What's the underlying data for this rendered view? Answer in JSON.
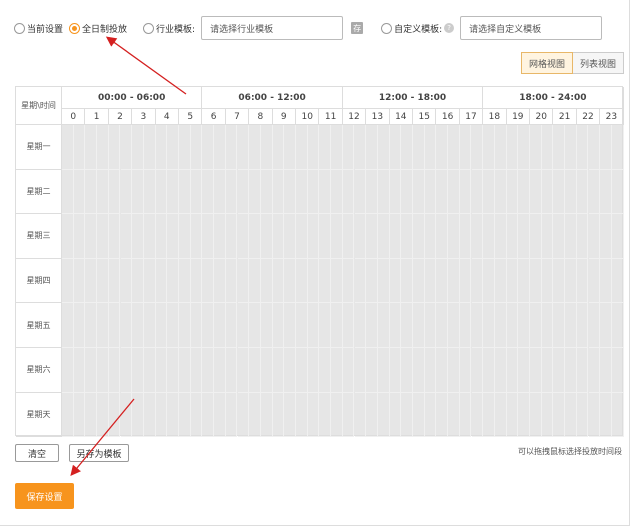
{
  "radios": [
    {
      "label": "当前设置",
      "checked": false
    },
    {
      "label": "全日制投放",
      "checked": true
    },
    {
      "label": "行业模板:",
      "checked": false
    },
    {
      "label": "自定义模板:",
      "checked": false
    }
  ],
  "industry_select": {
    "placeholder": "请选择行业模板"
  },
  "template_icon": "存",
  "custom_select": {
    "placeholder": "请选择自定义模板"
  },
  "help_icon": "?",
  "view_toggle": {
    "grid": "网格视图",
    "list": "列表视图",
    "active": "grid"
  },
  "schedule": {
    "corner": "星期\\时间",
    "periods": [
      "00:00 - 06:00",
      "06:00 - 12:00",
      "12:00 - 18:00",
      "18:00 - 24:00"
    ],
    "hours": [
      "0",
      "1",
      "2",
      "3",
      "4",
      "5",
      "6",
      "7",
      "8",
      "9",
      "10",
      "11",
      "12",
      "13",
      "14",
      "15",
      "16",
      "17",
      "18",
      "19",
      "20",
      "21",
      "22",
      "23"
    ],
    "days": [
      "星期一",
      "星期二",
      "星期三",
      "星期四",
      "星期五",
      "星期六",
      "星期天"
    ]
  },
  "buttons": {
    "clear": "清空",
    "save_template": "另存为模板",
    "save": "保存设置"
  },
  "hint": "可以拖拽鼠标选择投放时间段",
  "colors": {
    "accent": "#f7941d",
    "arrow": "#d42020",
    "cell_fill": "#e6e6e6"
  }
}
